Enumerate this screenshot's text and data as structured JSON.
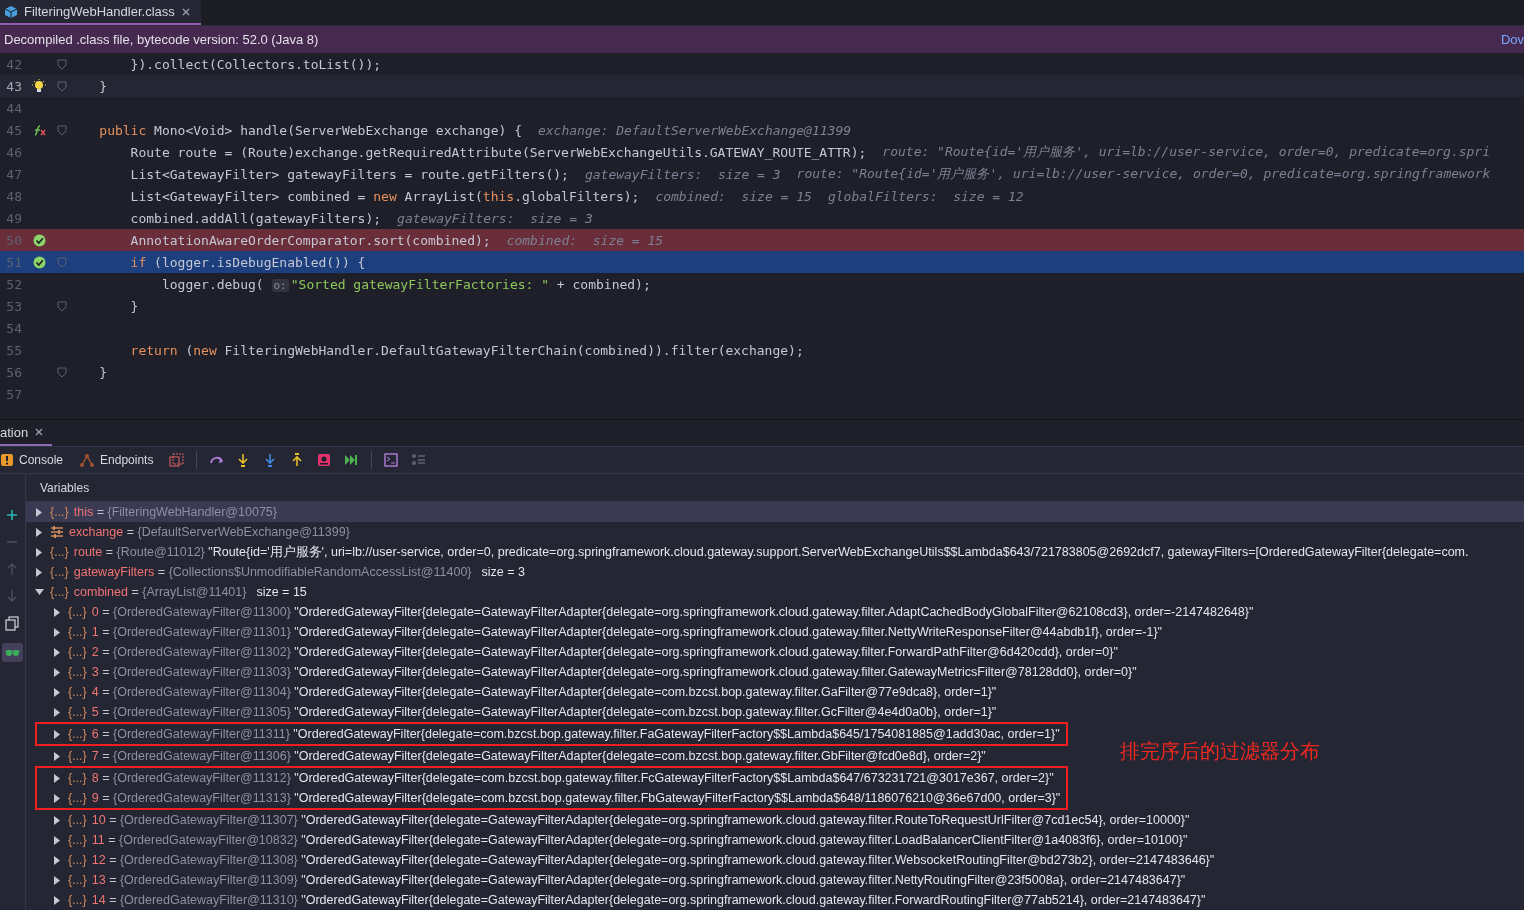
{
  "editor_tab": {
    "label": "FilteringWebHandler.class",
    "selected": true
  },
  "banner": {
    "text": "Decompiled .class file, bytecode version: 52.0 (Java 8)",
    "link": "Dov"
  },
  "code_lines": [
    {
      "number": "42",
      "fold": true,
      "bulb": false,
      "method_marker": false,
      "breakpoint": false,
      "current": false,
      "caret": false,
      "tokens": [
        {
          "kind": "plain",
          "text": "        }).collect(Collectors.toList());"
        }
      ]
    },
    {
      "number": "43",
      "fold": true,
      "bulb": true,
      "method_marker": false,
      "breakpoint": false,
      "current": false,
      "caret": true,
      "tokens": [
        {
          "kind": "plain",
          "text": "    }"
        }
      ]
    },
    {
      "number": "44",
      "fold": false,
      "bulb": false,
      "method_marker": false,
      "breakpoint": false,
      "current": false,
      "caret": false
    },
    {
      "number": "45",
      "fold": true,
      "bulb": false,
      "method_marker": true,
      "breakpoint": false,
      "current": false,
      "caret": false,
      "tokens": [
        {
          "kind": "keyword",
          "text": "    public"
        },
        {
          "kind": "plain",
          "text": " Mono<Void> handle(ServerWebExchange exchange) {"
        }
      ],
      "hints": [
        "exchange: DefaultServerWebExchange@11399"
      ]
    },
    {
      "number": "46",
      "fold": false,
      "bulb": false,
      "method_marker": false,
      "breakpoint": false,
      "current": false,
      "caret": false,
      "tokens": [
        {
          "kind": "plain",
          "text": "        Route route = (Route)exchange.getRequiredAttribute(ServerWebExchangeUtils.GATEWAY_ROUTE_ATTR);"
        }
      ],
      "hints": [
        "route: \"Route{id='用户服务', uri=lb://user-service, order=0, predicate=org.spri"
      ]
    },
    {
      "number": "47",
      "fold": false,
      "bulb": false,
      "method_marker": false,
      "breakpoint": false,
      "current": false,
      "caret": false,
      "tokens": [
        {
          "kind": "plain",
          "text": "        List<GatewayFilter> gatewayFilters = route.getFilters();"
        }
      ],
      "hints": [
        "gatewayFilters:  size = 3",
        "route: \"Route{id='用户服务', uri=lb://user-service, order=0, predicate=org.springframework"
      ]
    },
    {
      "number": "48",
      "fold": false,
      "bulb": false,
      "method_marker": false,
      "breakpoint": false,
      "current": false,
      "caret": false,
      "tokens": [
        {
          "kind": "plain",
          "text": "        List<GatewayFilter> combined = "
        },
        {
          "kind": "keyword",
          "text": "new"
        },
        {
          "kind": "plain",
          "text": " ArrayList("
        },
        {
          "kind": "keyword",
          "text": "this"
        },
        {
          "kind": "plain",
          "text": ".globalFilters);"
        }
      ],
      "hints": [
        "combined:  size = 15",
        "globalFilters:  size = 12"
      ]
    },
    {
      "number": "49",
      "fold": false,
      "bulb": false,
      "method_marker": false,
      "breakpoint": false,
      "current": false,
      "caret": false,
      "tokens": [
        {
          "kind": "plain",
          "text": "        combined.addAll(gatewayFilters);"
        }
      ],
      "hints": [
        "gatewayFilters:  size = 3"
      ]
    },
    {
      "number": "50",
      "fold": false,
      "bulb": false,
      "method_marker": false,
      "breakpoint": true,
      "current": false,
      "caret": false,
      "tokens": [
        {
          "kind": "plain",
          "text": "        AnnotationAwareOrderComparator.sort(combined);"
        }
      ],
      "hints": [
        "combined:  size = 15"
      ]
    },
    {
      "number": "51",
      "fold": true,
      "bulb": false,
      "method_marker": false,
      "breakpoint": true,
      "current": true,
      "caret": false,
      "tokens": [
        {
          "kind": "keyword",
          "text": "        if"
        },
        {
          "kind": "plain",
          "text": " (logger.isDebugEnabled()) {"
        }
      ]
    },
    {
      "number": "52",
      "fold": false,
      "bulb": false,
      "method_marker": false,
      "breakpoint": false,
      "current": false,
      "caret": false,
      "tokens": [
        {
          "kind": "plain",
          "text": "            logger.debug( "
        },
        {
          "kind": "param",
          "text": "o:"
        },
        {
          "kind": "string",
          "text": "\"Sorted gatewayFilterFactories: \""
        },
        {
          "kind": "plain",
          "text": " + combined);"
        }
      ]
    },
    {
      "number": "53",
      "fold": true,
      "bulb": false,
      "method_marker": false,
      "breakpoint": false,
      "current": false,
      "caret": false,
      "tokens": [
        {
          "kind": "plain",
          "text": "        }"
        }
      ]
    },
    {
      "number": "54",
      "fold": false,
      "bulb": false,
      "method_marker": false,
      "breakpoint": false,
      "current": false,
      "caret": false
    },
    {
      "number": "55",
      "fold": false,
      "bulb": false,
      "method_marker": false,
      "breakpoint": false,
      "current": false,
      "caret": false,
      "tokens": [
        {
          "kind": "keyword",
          "text": "        return"
        },
        {
          "kind": "plain",
          "text": " ("
        },
        {
          "kind": "keyword",
          "text": "new"
        },
        {
          "kind": "plain",
          "text": " FilteringWebHandler.DefaultGatewayFilterChain(combined)).filter(exchange);"
        }
      ]
    },
    {
      "number": "56",
      "fold": true,
      "bulb": false,
      "method_marker": false,
      "breakpoint": false,
      "current": false,
      "caret": false,
      "tokens": [
        {
          "kind": "plain",
          "text": "    }"
        }
      ]
    },
    {
      "number": "57",
      "fold": false,
      "bulb": false,
      "method_marker": false,
      "breakpoint": false,
      "current": false,
      "caret": false
    }
  ],
  "debug_tab": {
    "label": "ation",
    "selected": true
  },
  "toolbar": [
    {
      "label": "Console"
    },
    {
      "label": "Endpoints"
    }
  ],
  "variables": {
    "title": "Variables",
    "rows": [
      {
        "kind": "object",
        "glyph": "{...}",
        "name": "this",
        "operator": "=",
        "ref": "{FilteringWebHandler@10075}",
        "expanded": false,
        "selected": true
      },
      {
        "kind": "params",
        "name": "exchange",
        "operator": "=",
        "ref": "{DefaultServerWebExchange@11399}",
        "expanded": false,
        "selected": false
      },
      {
        "kind": "object",
        "glyph": "{...}",
        "name": "route",
        "operator": "=",
        "ref": "{Route@11012}",
        "value": "\"Route{id='用户服务', uri=lb://user-service, order=0, predicate=org.springframework.cloud.gateway.support.ServerWebExchangeUtils$$Lambda$643/721783805@2692dcf7, gatewayFilters=[OrderedGatewayFilter{delegate=com.",
        "expanded": false,
        "selected": false
      },
      {
        "kind": "object",
        "glyph": "{...}",
        "name": "gatewayFilters",
        "operator": "=",
        "ref": "{Collections$UnmodifiableRandomAccessList@11400}",
        "extra": "size = 3",
        "expanded": false,
        "selected": false
      },
      {
        "kind": "object",
        "glyph": "{...}",
        "name": "combined",
        "operator": "=",
        "ref": "{ArrayList@11401}",
        "extra": "size = 15",
        "expanded": true,
        "selected": false,
        "children": [
          {
            "kind": "object",
            "glyph": "{...}",
            "name": "0",
            "operator": "=",
            "ref": "{OrderedGatewayFilter@11300}",
            "value": "\"OrderedGatewayFilter{delegate=GatewayFilterAdapter{delegate=org.springframework.cloud.gateway.filter.AdaptCachedBodyGlobalFilter@62108cd3}, order=-2147482648}\"",
            "expanded": false,
            "selected": false,
            "marked": false
          },
          {
            "kind": "object",
            "glyph": "{...}",
            "name": "1",
            "operator": "=",
            "ref": "{OrderedGatewayFilter@11301}",
            "value": "\"OrderedGatewayFilter{delegate=GatewayFilterAdapter{delegate=org.springframework.cloud.gateway.filter.NettyWriteResponseFilter@44abdb1f}, order=-1}\"",
            "expanded": false,
            "selected": false,
            "marked": false
          },
          {
            "kind": "object",
            "glyph": "{...}",
            "name": "2",
            "operator": "=",
            "ref": "{OrderedGatewayFilter@11302}",
            "value": "\"OrderedGatewayFilter{delegate=GatewayFilterAdapter{delegate=org.springframework.cloud.gateway.filter.ForwardPathFilter@6d420cdd}, order=0}\"",
            "expanded": false,
            "selected": false,
            "marked": false
          },
          {
            "kind": "object",
            "glyph": "{...}",
            "name": "3",
            "operator": "=",
            "ref": "{OrderedGatewayFilter@11303}",
            "value": "\"OrderedGatewayFilter{delegate=GatewayFilterAdapter{delegate=org.springframework.cloud.gateway.filter.GatewayMetricsFilter@78128dd0}, order=0}\"",
            "expanded": false,
            "selected": false,
            "marked": false
          },
          {
            "kind": "object",
            "glyph": "{...}",
            "name": "4",
            "operator": "=",
            "ref": "{OrderedGatewayFilter@11304}",
            "value": "\"OrderedGatewayFilter{delegate=GatewayFilterAdapter{delegate=com.bzcst.bop.gateway.filter.GaFilter@77e9dca8}, order=1}\"",
            "expanded": false,
            "selected": false,
            "marked": false
          },
          {
            "kind": "object",
            "glyph": "{...}",
            "name": "5",
            "operator": "=",
            "ref": "{OrderedGatewayFilter@11305}",
            "value": "\"OrderedGatewayFilter{delegate=GatewayFilterAdapter{delegate=com.bzcst.bop.gateway.filter.GcFilter@4e4d0a0b}, order=1}\"",
            "expanded": false,
            "selected": false,
            "marked": false
          },
          {
            "kind": "object",
            "glyph": "{...}",
            "name": "6",
            "operator": "=",
            "ref": "{OrderedGatewayFilter@11311}",
            "value": "\"OrderedGatewayFilter{delegate=com.bzcst.bop.gateway.filter.FaGatewayFilterFactory$$Lambda$645/1754081885@1add30ac, order=1}\"",
            "expanded": false,
            "selected": false,
            "marked": true
          },
          {
            "kind": "object",
            "glyph": "{...}",
            "name": "7",
            "operator": "=",
            "ref": "{OrderedGatewayFilter@11306}",
            "value": "\"OrderedGatewayFilter{delegate=GatewayFilterAdapter{delegate=com.bzcst.bop.gateway.filter.GbFilter@fcd0e8d}, order=2}\"",
            "expanded": false,
            "selected": false,
            "marked": false
          },
          {
            "kind": "object",
            "glyph": "{...}",
            "name": "8",
            "operator": "=",
            "ref": "{OrderedGatewayFilter@11312}",
            "value": "\"OrderedGatewayFilter{delegate=com.bzcst.bop.gateway.filter.FcGatewayFilterFactory$$Lambda$647/673231721@3017e367, order=2}\"",
            "expanded": false,
            "selected": false,
            "marked": true
          },
          {
            "kind": "object",
            "glyph": "{...}",
            "name": "9",
            "operator": "=",
            "ref": "{OrderedGatewayFilter@11313}",
            "value": "\"OrderedGatewayFilter{delegate=com.bzcst.bop.gateway.filter.FbGatewayFilterFactory$$Lambda$648/1186076210@36e67d00, order=3}\"",
            "expanded": false,
            "selected": false,
            "marked": true
          },
          {
            "kind": "object",
            "glyph": "{...}",
            "name": "10",
            "operator": "=",
            "ref": "{OrderedGatewayFilter@11307}",
            "value": "\"OrderedGatewayFilter{delegate=GatewayFilterAdapter{delegate=org.springframework.cloud.gateway.filter.RouteToRequestUrlFilter@7cd1ec54}, order=10000}\"",
            "expanded": false,
            "selected": false,
            "marked": false
          },
          {
            "kind": "object",
            "glyph": "{...}",
            "name": "11",
            "operator": "=",
            "ref": "{OrderedGatewayFilter@10832}",
            "value": "\"OrderedGatewayFilter{delegate=GatewayFilterAdapter{delegate=org.springframework.cloud.gateway.filter.LoadBalancerClientFilter@1a4083f6}, order=10100}\"",
            "expanded": false,
            "selected": false,
            "marked": false
          },
          {
            "kind": "object",
            "glyph": "{...}",
            "name": "12",
            "operator": "=",
            "ref": "{OrderedGatewayFilter@11308}",
            "value": "\"OrderedGatewayFilter{delegate=GatewayFilterAdapter{delegate=org.springframework.cloud.gateway.filter.WebsocketRoutingFilter@bd273b2}, order=2147483646}\"",
            "expanded": false,
            "selected": false,
            "marked": false
          },
          {
            "kind": "object",
            "glyph": "{...}",
            "name": "13",
            "operator": "=",
            "ref": "{OrderedGatewayFilter@11309}",
            "value": "\"OrderedGatewayFilter{delegate=GatewayFilterAdapter{delegate=org.springframework.cloud.gateway.filter.NettyRoutingFilter@23f5008a}, order=2147483647}\"",
            "expanded": false,
            "selected": false,
            "marked": false
          },
          {
            "kind": "object",
            "glyph": "{...}",
            "name": "14",
            "operator": "=",
            "ref": "{OrderedGatewayFilter@11310}",
            "value": "\"OrderedGatewayFilter{delegate=GatewayFilterAdapter{delegate=org.springframework.cloud.gateway.filter.ForwardRoutingFilter@77ab5214}, order=2147483647}\"",
            "expanded": false,
            "selected": false,
            "marked": false
          }
        ]
      }
    ]
  },
  "annotation": {
    "text": "排完序后的过滤器分布"
  }
}
